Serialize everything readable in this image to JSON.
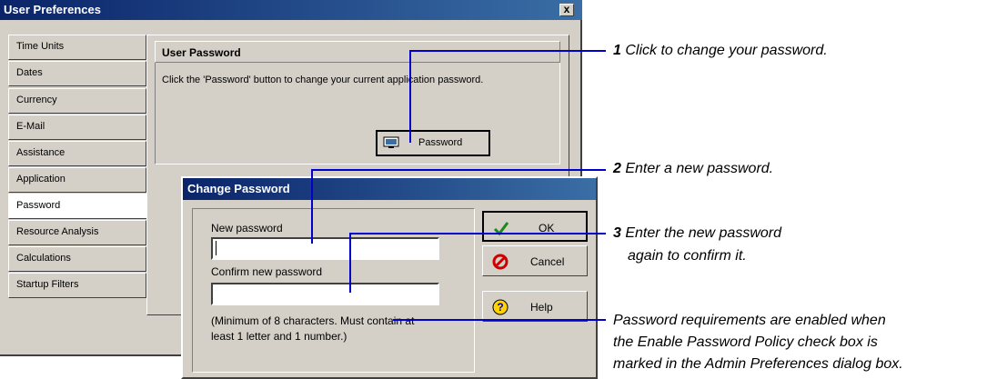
{
  "prefs_window": {
    "title": "User Preferences",
    "close_glyph": "x",
    "sidebar": [
      {
        "label": "Time Units"
      },
      {
        "label": "Dates"
      },
      {
        "label": "Currency"
      },
      {
        "label": "E-Mail"
      },
      {
        "label": "Assistance"
      },
      {
        "label": "Application"
      },
      {
        "label": "Password"
      },
      {
        "label": "Resource Analysis"
      },
      {
        "label": "Calculations"
      },
      {
        "label": "Startup Filters"
      }
    ],
    "section_title": "User Password",
    "description": "Click the 'Password' button to change your current application password.",
    "password_button": "Password"
  },
  "change_dialog": {
    "title": "Change Password",
    "new_label": "New password",
    "new_value": "",
    "confirm_label": "Confirm new password",
    "confirm_value": "",
    "requirements": "(Minimum of 8 characters. Must contain at least 1 letter and 1 number.)",
    "ok": "OK",
    "cancel": "Cancel",
    "help": "Help",
    "icons": {
      "ok": "checkmark-icon",
      "cancel": "cancel-icon",
      "help": "help-icon",
      "password": "password-icon"
    }
  },
  "callouts": {
    "c1_num": "1",
    "c1_text": "Click to change your password.",
    "c2_num": "2",
    "c2_text": "Enter a new password.",
    "c3_num": "3",
    "c3_line1": "Enter the new password",
    "c3_line2": "again to confirm it.",
    "c4_line1": "Password requirements are enabled when",
    "c4_line2": "the Enable Password Policy check box is",
    "c4_line3": "marked in the Admin Preferences dialog box."
  },
  "colors": {
    "title_bar": "#0a246a",
    "callout_line": "#0000cc",
    "window_face": "#d4d0c8"
  }
}
